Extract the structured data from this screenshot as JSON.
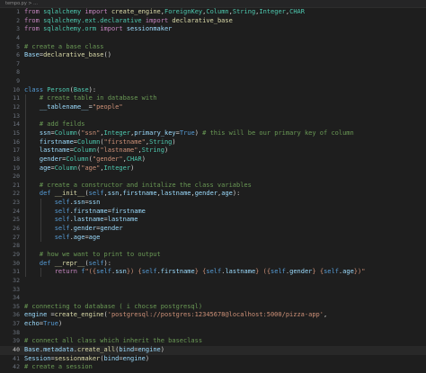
{
  "breadcrumb": "tempo.py > ...",
  "lines": [
    {
      "n": "1",
      "seg": [
        [
          "kw",
          "from"
        ],
        [
          "plain",
          " "
        ],
        [
          "cls",
          "sqlalchemy"
        ],
        [
          "plain",
          " "
        ],
        [
          "kw",
          "import"
        ],
        [
          "plain",
          " "
        ],
        [
          "fn",
          "create_engine"
        ],
        [
          "plain",
          ","
        ],
        [
          "cls",
          "ForeignKey"
        ],
        [
          "plain",
          ","
        ],
        [
          "cls",
          "Column"
        ],
        [
          "plain",
          ","
        ],
        [
          "cls",
          "String"
        ],
        [
          "plain",
          ","
        ],
        [
          "cls",
          "Integer"
        ],
        [
          "plain",
          ","
        ],
        [
          "cls",
          "CHAR"
        ]
      ]
    },
    {
      "n": "2",
      "seg": [
        [
          "kw",
          "from"
        ],
        [
          "plain",
          " "
        ],
        [
          "cls",
          "sqlalchemy.ext.declarative"
        ],
        [
          "plain",
          " "
        ],
        [
          "kw",
          "import"
        ],
        [
          "plain",
          " "
        ],
        [
          "fn",
          "declarative_base"
        ]
      ]
    },
    {
      "n": "3",
      "seg": [
        [
          "kw",
          "from"
        ],
        [
          "plain",
          " "
        ],
        [
          "cls",
          "sqlalchemy.orm"
        ],
        [
          "plain",
          " "
        ],
        [
          "kw",
          "import"
        ],
        [
          "plain",
          " "
        ],
        [
          "var",
          "sessionmaker"
        ]
      ]
    },
    {
      "n": "4",
      "seg": []
    },
    {
      "n": "5",
      "seg": [
        [
          "cmt",
          "# create a base class"
        ]
      ]
    },
    {
      "n": "6",
      "seg": [
        [
          "var",
          "Base"
        ],
        [
          "plain",
          "="
        ],
        [
          "fn",
          "declarative_base"
        ],
        [
          "plain",
          "()"
        ]
      ]
    },
    {
      "n": "7",
      "seg": []
    },
    {
      "n": "8",
      "seg": []
    },
    {
      "n": "9",
      "seg": []
    },
    {
      "n": "10",
      "seg": [
        [
          "def",
          "class"
        ],
        [
          "plain",
          " "
        ],
        [
          "cls",
          "Person"
        ],
        [
          "plain",
          "("
        ],
        [
          "cls",
          "Base"
        ],
        [
          "plain",
          "):"
        ]
      ]
    },
    {
      "n": "11",
      "seg": [
        [
          "plain",
          "    "
        ],
        [
          "cmt",
          "# create table in database with"
        ]
      ]
    },
    {
      "n": "12",
      "seg": [
        [
          "plain",
          "    "
        ],
        [
          "var",
          "__tablename__"
        ],
        [
          "plain",
          "="
        ],
        [
          "str",
          "\"people\""
        ]
      ]
    },
    {
      "n": "13",
      "seg": []
    },
    {
      "n": "14",
      "seg": [
        [
          "plain",
          "    "
        ],
        [
          "cmt",
          "# add feilds"
        ]
      ]
    },
    {
      "n": "15",
      "seg": [
        [
          "plain",
          "    "
        ],
        [
          "var",
          "ssn"
        ],
        [
          "plain",
          "="
        ],
        [
          "cls",
          "Column"
        ],
        [
          "plain",
          "("
        ],
        [
          "str",
          "\"ssn\""
        ],
        [
          "plain",
          ","
        ],
        [
          "cls",
          "Integer"
        ],
        [
          "plain",
          ","
        ],
        [
          "var",
          "primary_key"
        ],
        [
          "plain",
          "="
        ],
        [
          "def",
          "True"
        ],
        [
          "plain",
          ") "
        ],
        [
          "cmt",
          "# this will be our primary key of column"
        ]
      ]
    },
    {
      "n": "16",
      "seg": [
        [
          "plain",
          "    "
        ],
        [
          "var",
          "firstname"
        ],
        [
          "plain",
          "="
        ],
        [
          "cls",
          "Column"
        ],
        [
          "plain",
          "("
        ],
        [
          "str",
          "\"firstname\""
        ],
        [
          "plain",
          ","
        ],
        [
          "cls",
          "String"
        ],
        [
          "plain",
          ")"
        ]
      ]
    },
    {
      "n": "17",
      "seg": [
        [
          "plain",
          "    "
        ],
        [
          "var",
          "lastname"
        ],
        [
          "plain",
          "="
        ],
        [
          "cls",
          "Column"
        ],
        [
          "plain",
          "("
        ],
        [
          "str",
          "\"lastname\""
        ],
        [
          "plain",
          ","
        ],
        [
          "cls",
          "String"
        ],
        [
          "plain",
          ")"
        ]
      ]
    },
    {
      "n": "18",
      "seg": [
        [
          "plain",
          "    "
        ],
        [
          "var",
          "gender"
        ],
        [
          "plain",
          "="
        ],
        [
          "cls",
          "Column"
        ],
        [
          "plain",
          "("
        ],
        [
          "str",
          "\"gender\""
        ],
        [
          "plain",
          ","
        ],
        [
          "cls",
          "CHAR"
        ],
        [
          "plain",
          ")"
        ]
      ]
    },
    {
      "n": "19",
      "seg": [
        [
          "plain",
          "    "
        ],
        [
          "var",
          "age"
        ],
        [
          "plain",
          "="
        ],
        [
          "cls",
          "Column"
        ],
        [
          "plain",
          "("
        ],
        [
          "str",
          "\"age\""
        ],
        [
          "plain",
          ","
        ],
        [
          "cls",
          "Integer"
        ],
        [
          "plain",
          ")"
        ]
      ]
    },
    {
      "n": "20",
      "seg": []
    },
    {
      "n": "21",
      "seg": [
        [
          "plain",
          "    "
        ],
        [
          "cmt",
          "# create a constructor and initalize the class variables"
        ]
      ]
    },
    {
      "n": "22",
      "seg": [
        [
          "plain",
          "    "
        ],
        [
          "def",
          "def"
        ],
        [
          "plain",
          " "
        ],
        [
          "fn",
          "__init__"
        ],
        [
          "plain",
          "("
        ],
        [
          "self",
          "self"
        ],
        [
          "plain",
          ","
        ],
        [
          "var",
          "ssn"
        ],
        [
          "plain",
          ","
        ],
        [
          "var",
          "firstname"
        ],
        [
          "plain",
          ","
        ],
        [
          "var",
          "lastname"
        ],
        [
          "plain",
          ","
        ],
        [
          "var",
          "gender"
        ],
        [
          "plain",
          ","
        ],
        [
          "var",
          "age"
        ],
        [
          "plain",
          "):"
        ]
      ]
    },
    {
      "n": "23",
      "seg": [
        [
          "plain",
          "        "
        ],
        [
          "self",
          "self"
        ],
        [
          "plain",
          "."
        ],
        [
          "var",
          "ssn"
        ],
        [
          "plain",
          "="
        ],
        [
          "var",
          "ssn"
        ]
      ]
    },
    {
      "n": "24",
      "seg": [
        [
          "plain",
          "        "
        ],
        [
          "self",
          "self"
        ],
        [
          "plain",
          "."
        ],
        [
          "var",
          "firstname"
        ],
        [
          "plain",
          "="
        ],
        [
          "var",
          "firstname"
        ]
      ]
    },
    {
      "n": "25",
      "seg": [
        [
          "plain",
          "        "
        ],
        [
          "self",
          "self"
        ],
        [
          "plain",
          "."
        ],
        [
          "var",
          "lastname"
        ],
        [
          "plain",
          "="
        ],
        [
          "var",
          "lastname"
        ]
      ]
    },
    {
      "n": "26",
      "seg": [
        [
          "plain",
          "        "
        ],
        [
          "self",
          "self"
        ],
        [
          "plain",
          "."
        ],
        [
          "var",
          "gender"
        ],
        [
          "plain",
          "="
        ],
        [
          "var",
          "gender"
        ]
      ]
    },
    {
      "n": "27",
      "seg": [
        [
          "plain",
          "        "
        ],
        [
          "self",
          "self"
        ],
        [
          "plain",
          "."
        ],
        [
          "var",
          "age"
        ],
        [
          "plain",
          "="
        ],
        [
          "var",
          "age"
        ]
      ]
    },
    {
      "n": "28",
      "seg": []
    },
    {
      "n": "29",
      "seg": [
        [
          "plain",
          "    "
        ],
        [
          "cmt",
          "# how we want to print to output"
        ]
      ]
    },
    {
      "n": "30",
      "seg": [
        [
          "plain",
          "    "
        ],
        [
          "def",
          "def"
        ],
        [
          "plain",
          " "
        ],
        [
          "fn",
          "__repr__"
        ],
        [
          "plain",
          "("
        ],
        [
          "self",
          "self"
        ],
        [
          "plain",
          "):"
        ]
      ]
    },
    {
      "n": "31",
      "seg": [
        [
          "plain",
          "        "
        ],
        [
          "kw",
          "return"
        ],
        [
          "plain",
          " "
        ],
        [
          "def",
          "f"
        ],
        [
          "str",
          "\"({"
        ],
        [
          "self",
          "self"
        ],
        [
          "plain",
          "."
        ],
        [
          "var",
          "ssn"
        ],
        [
          "str",
          "}) {"
        ],
        [
          "self",
          "self"
        ],
        [
          "plain",
          "."
        ],
        [
          "var",
          "firstname"
        ],
        [
          "str",
          "} {"
        ],
        [
          "self",
          "self"
        ],
        [
          "plain",
          "."
        ],
        [
          "var",
          "lastname"
        ],
        [
          "str",
          "} ({"
        ],
        [
          "self",
          "self"
        ],
        [
          "plain",
          "."
        ],
        [
          "var",
          "gender"
        ],
        [
          "str",
          "} {"
        ],
        [
          "self",
          "self"
        ],
        [
          "plain",
          "."
        ],
        [
          "var",
          "age"
        ],
        [
          "str",
          "})\""
        ]
      ]
    },
    {
      "n": "32",
      "seg": []
    },
    {
      "n": "33",
      "seg": []
    },
    {
      "n": "34",
      "seg": []
    },
    {
      "n": "35",
      "seg": [
        [
          "cmt",
          "# connecting to database ( i chocse postgresql)"
        ]
      ]
    },
    {
      "n": "36",
      "seg": [
        [
          "var",
          "engine"
        ],
        [
          "plain",
          " ="
        ],
        [
          "fn",
          "create_engine"
        ],
        [
          "plain",
          "("
        ],
        [
          "str",
          "'postgresql://postgres:12345678@localhost:5000/pizza-app'"
        ],
        [
          "plain",
          ","
        ]
      ]
    },
    {
      "n": "37",
      "seg": [
        [
          "var",
          "echo"
        ],
        [
          "plain",
          "="
        ],
        [
          "def",
          "True"
        ],
        [
          "plain",
          ")"
        ]
      ]
    },
    {
      "n": "38",
      "seg": []
    },
    {
      "n": "39",
      "seg": [
        [
          "cmt",
          "# connect all class which inherit the baseclass"
        ]
      ]
    },
    {
      "n": "40",
      "seg": [
        [
          "var",
          "Base"
        ],
        [
          "plain",
          "."
        ],
        [
          "var",
          "metadata"
        ],
        [
          "plain",
          "."
        ],
        [
          "fn",
          "create_all"
        ],
        [
          "plain",
          "("
        ],
        [
          "var",
          "bind"
        ],
        [
          "plain",
          "="
        ],
        [
          "var",
          "engine"
        ],
        [
          "plain",
          ")"
        ]
      ],
      "active": true
    },
    {
      "n": "41",
      "seg": [
        [
          "var",
          "Session"
        ],
        [
          "plain",
          "="
        ],
        [
          "fn",
          "sessionmaker"
        ],
        [
          "plain",
          "("
        ],
        [
          "var",
          "bind"
        ],
        [
          "plain",
          "="
        ],
        [
          "var",
          "engine"
        ],
        [
          "plain",
          ")"
        ]
      ]
    },
    {
      "n": "42",
      "seg": [
        [
          "cmt",
          "# create a session"
        ]
      ]
    }
  ]
}
